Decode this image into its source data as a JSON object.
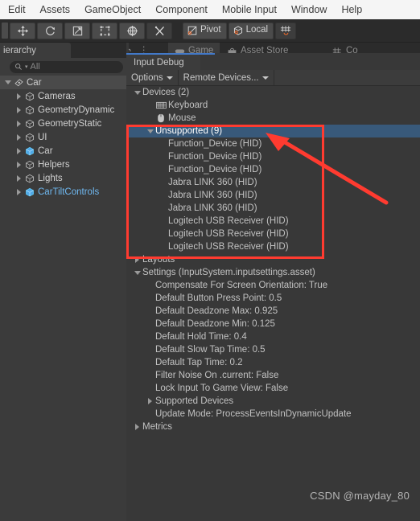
{
  "menubar": {
    "items": [
      {
        "label": "Edit"
      },
      {
        "label": "Assets"
      },
      {
        "label": "GameObject"
      },
      {
        "label": "Component"
      },
      {
        "label": "Mobile Input"
      },
      {
        "label": "Window"
      },
      {
        "label": "Help"
      }
    ]
  },
  "toolbar": {
    "pivot_label": "Pivot",
    "local_label": "Local",
    "tools": [
      {
        "name": "hand-tool"
      },
      {
        "name": "move-tool"
      },
      {
        "name": "rotate-tool"
      },
      {
        "name": "scale-tool"
      },
      {
        "name": "rect-tool"
      },
      {
        "name": "transform-tool"
      },
      {
        "name": "custom-tool"
      }
    ]
  },
  "background_tabs": [
    {
      "label": "Game"
    },
    {
      "label": "Asset Store"
    },
    {
      "label": "Co"
    }
  ],
  "hierarchy": {
    "tab_label": "ierarchy",
    "search_placeholder": "All",
    "tree": [
      {
        "label": "Car",
        "depth": 0,
        "expanded": true,
        "icon": "scene-icon",
        "selected_row": true,
        "prefab": false
      },
      {
        "label": "Cameras",
        "depth": 1,
        "expanded": false,
        "icon": "gameobject-icon",
        "prefab": false
      },
      {
        "label": "GeometryDynamic",
        "depth": 1,
        "expanded": false,
        "icon": "gameobject-icon",
        "prefab": false
      },
      {
        "label": "GeometryStatic",
        "depth": 1,
        "expanded": false,
        "icon": "gameobject-icon",
        "prefab": false
      },
      {
        "label": "UI",
        "depth": 1,
        "expanded": false,
        "icon": "gameobject-icon",
        "prefab": false
      },
      {
        "label": "Car",
        "depth": 1,
        "expanded": false,
        "icon": "prefab-icon",
        "prefab": true
      },
      {
        "label": "Helpers",
        "depth": 1,
        "expanded": false,
        "icon": "gameobject-icon",
        "prefab": false
      },
      {
        "label": "Lights",
        "depth": 1,
        "expanded": false,
        "icon": "gameobject-icon",
        "prefab": false
      },
      {
        "label": "CarTiltControls",
        "depth": 1,
        "expanded": false,
        "icon": "prefab-icon",
        "prefab": true,
        "label_blue": true
      }
    ]
  },
  "input_debug": {
    "tab_label": "Input Debug",
    "options_label": "Options",
    "remote_devices_label": "Remote Devices...",
    "tree": [
      {
        "label": "Devices (2)",
        "depth": 0,
        "toggle": "open",
        "icon": null,
        "selected": false
      },
      {
        "label": "Keyboard",
        "depth": 1,
        "toggle": "none",
        "icon": "keyboard-icon",
        "selected": false
      },
      {
        "label": "Mouse",
        "depth": 1,
        "toggle": "none",
        "icon": "mouse-icon",
        "selected": false
      },
      {
        "label": "Unsupported (9)",
        "depth": 1,
        "toggle": "open",
        "icon": null,
        "selected": true
      },
      {
        "label": "Function_Device (HID)",
        "depth": 2,
        "toggle": "none",
        "icon": null,
        "selected": false
      },
      {
        "label": "Function_Device (HID)",
        "depth": 2,
        "toggle": "none",
        "icon": null,
        "selected": false
      },
      {
        "label": "Function_Device (HID)",
        "depth": 2,
        "toggle": "none",
        "icon": null,
        "selected": false
      },
      {
        "label": "Jabra LINK 360 (HID)",
        "depth": 2,
        "toggle": "none",
        "icon": null,
        "selected": false
      },
      {
        "label": "Jabra LINK 360 (HID)",
        "depth": 2,
        "toggle": "none",
        "icon": null,
        "selected": false
      },
      {
        "label": "Jabra LINK 360 (HID)",
        "depth": 2,
        "toggle": "none",
        "icon": null,
        "selected": false
      },
      {
        "label": "Logitech USB Receiver (HID)",
        "depth": 2,
        "toggle": "none",
        "icon": null,
        "selected": false
      },
      {
        "label": "Logitech USB Receiver (HID)",
        "depth": 2,
        "toggle": "none",
        "icon": null,
        "selected": false
      },
      {
        "label": "Logitech USB Receiver (HID)",
        "depth": 2,
        "toggle": "none",
        "icon": null,
        "selected": false
      },
      {
        "label": "Layouts",
        "depth": 0,
        "toggle": "closed",
        "icon": null,
        "selected": false
      },
      {
        "label": "Settings (InputSystem.inputsettings.asset)",
        "depth": 0,
        "toggle": "open",
        "icon": null,
        "selected": false
      },
      {
        "label": "Compensate For Screen Orientation: True",
        "depth": 1,
        "toggle": "none",
        "icon": null,
        "selected": false
      },
      {
        "label": "Default Button Press Point: 0.5",
        "depth": 1,
        "toggle": "none",
        "icon": null,
        "selected": false
      },
      {
        "label": "Default Deadzone Max: 0.925",
        "depth": 1,
        "toggle": "none",
        "icon": null,
        "selected": false
      },
      {
        "label": "Default Deadzone Min: 0.125",
        "depth": 1,
        "toggle": "none",
        "icon": null,
        "selected": false
      },
      {
        "label": "Default Hold Time: 0.4",
        "depth": 1,
        "toggle": "none",
        "icon": null,
        "selected": false
      },
      {
        "label": "Default Slow Tap Time: 0.5",
        "depth": 1,
        "toggle": "none",
        "icon": null,
        "selected": false
      },
      {
        "label": "Default Tap Time: 0.2",
        "depth": 1,
        "toggle": "none",
        "icon": null,
        "selected": false
      },
      {
        "label": "Filter Noise On .current: False",
        "depth": 1,
        "toggle": "none",
        "icon": null,
        "selected": false
      },
      {
        "label": "Lock Input To Game View: False",
        "depth": 1,
        "toggle": "none",
        "icon": null,
        "selected": false
      },
      {
        "label": "Supported Devices",
        "depth": 1,
        "toggle": "closed",
        "icon": null,
        "selected": false
      },
      {
        "label": "Update Mode: ProcessEventsInDynamicUpdate",
        "depth": 1,
        "toggle": "none",
        "icon": null,
        "selected": false
      },
      {
        "label": "Metrics",
        "depth": 0,
        "toggle": "closed",
        "icon": null,
        "selected": false
      }
    ]
  },
  "annotation": {
    "box_color": "#ff3b30",
    "arrow_color": "#ff3b30"
  },
  "watermark": {
    "text": "CSDN @mayday_80"
  }
}
